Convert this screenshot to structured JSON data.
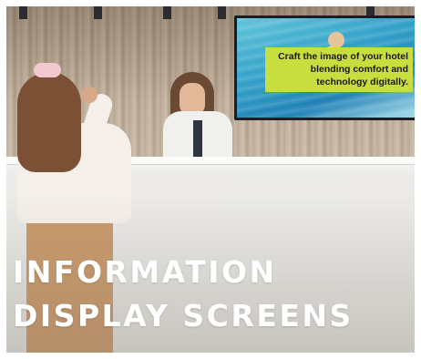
{
  "callout": {
    "lines": [
      "Craft the image of your hotel",
      "blending comfort and",
      "technology digitally."
    ],
    "background_color": "#c8dd3e"
  },
  "headline": {
    "lines": [
      "INFORMATION",
      "DISPLAY SCREENS"
    ],
    "color": "#ffffff"
  }
}
